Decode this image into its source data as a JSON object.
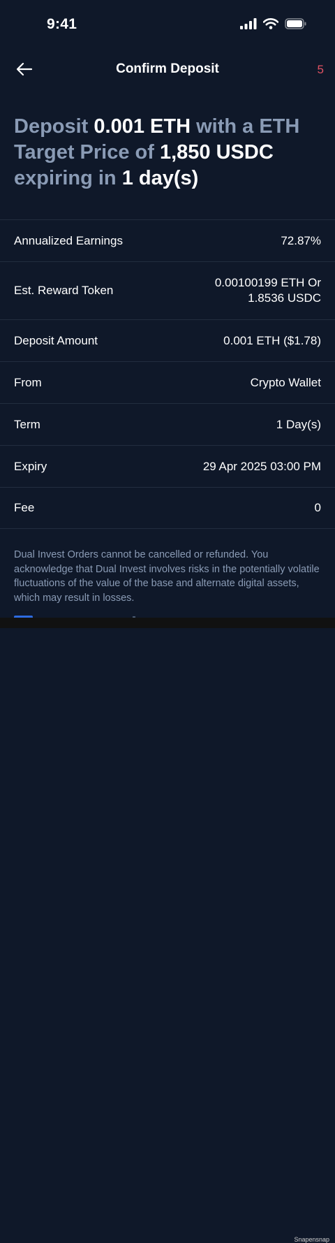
{
  "status_bar": {
    "time": "9:41"
  },
  "header": {
    "title": "Confirm Deposit",
    "count": "5"
  },
  "summary": {
    "prefix": "Deposit",
    "amount": "0.001 ETH",
    "mid1": "with a",
    "asset": "ETH",
    "mid2": "Target Price of",
    "price": "1,850",
    "currency": "USDC",
    "mid3": "expiring in",
    "duration": "1 day(s)"
  },
  "details": [
    {
      "label": "Annualized Earnings",
      "value": "72.87%"
    },
    {
      "label": "Est. Reward Token",
      "value_line1": "0.00100199 ETH Or",
      "value_line2": "1.8536 USDC"
    },
    {
      "label": "Deposit Amount",
      "value": "0.001 ETH ($1.78)"
    },
    {
      "label": "From",
      "value": "Crypto Wallet"
    },
    {
      "label": "Term",
      "value": "1 Day(s)"
    },
    {
      "label": "Expiry",
      "value": "29 Apr 2025 03:00 PM"
    },
    {
      "label": "Fee",
      "value": "0"
    }
  ],
  "disclaimer": "Dual Invest Orders cannot be cancelled or refunded. You acknowledge that Dual Invest involves risks in the potentially volatile fluctuations of the value of the base and alternate digital assets, which may result in losses.",
  "watermark": "Snapensnap",
  "colors": {
    "background": "#0f1829",
    "muted": "#8a9bb5",
    "accent_count": "#e05263",
    "divider": "#222d3f"
  }
}
